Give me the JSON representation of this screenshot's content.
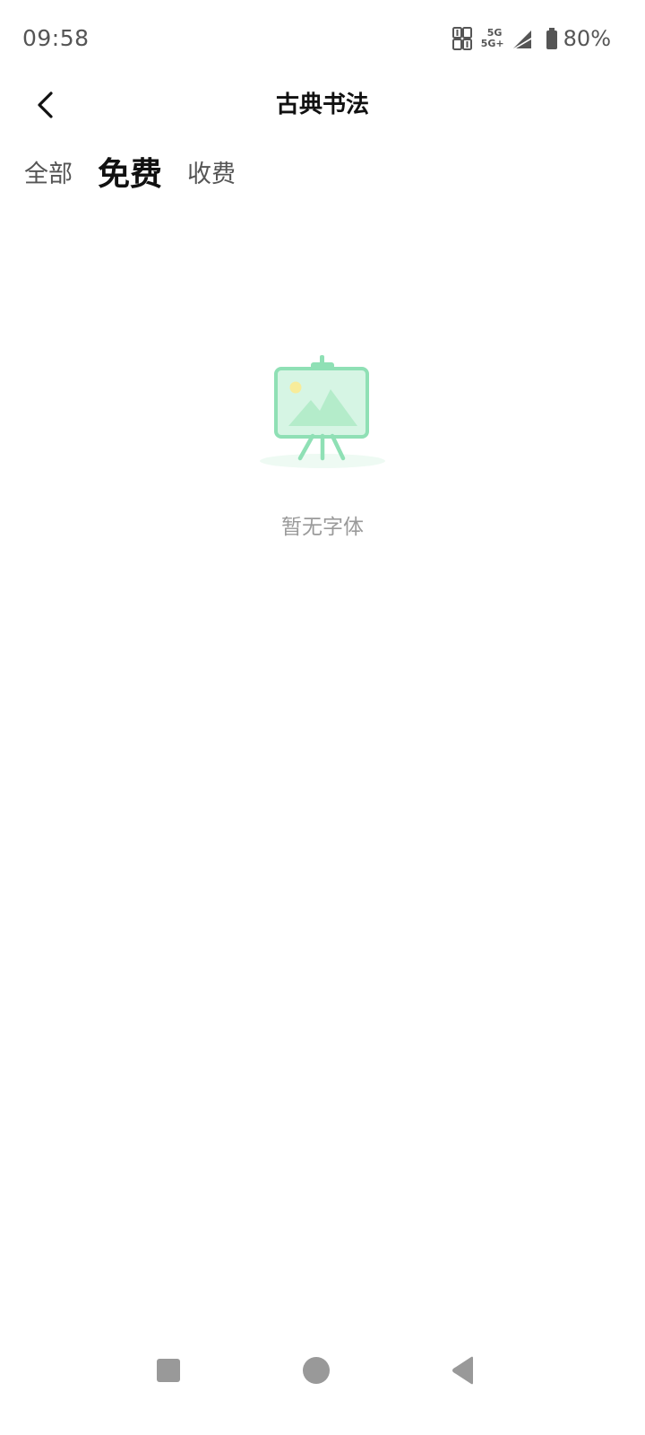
{
  "status_bar": {
    "time": "09:58",
    "network_top": "5G",
    "network_bottom": "5G+",
    "battery": "80%",
    "icons": [
      "hd-icon",
      "signal-icon",
      "battery-icon"
    ]
  },
  "header": {
    "title": "古典书法",
    "back_icon": "chevron-left-icon"
  },
  "tabs": [
    {
      "label": "全部",
      "active": false
    },
    {
      "label": "免费",
      "active": true
    },
    {
      "label": "收费",
      "active": false
    }
  ],
  "empty_state": {
    "illustration": "easel-picture-icon",
    "message": "暂无字体",
    "colors": {
      "frame": "#8fe0b5",
      "fill": "#d6f5e4",
      "mountain": "#b4ecca",
      "sun": "#f8ec9a"
    }
  },
  "nav_bar": {
    "buttons": [
      "recent-apps-icon",
      "home-icon",
      "back-icon"
    ],
    "color": "#999999"
  }
}
